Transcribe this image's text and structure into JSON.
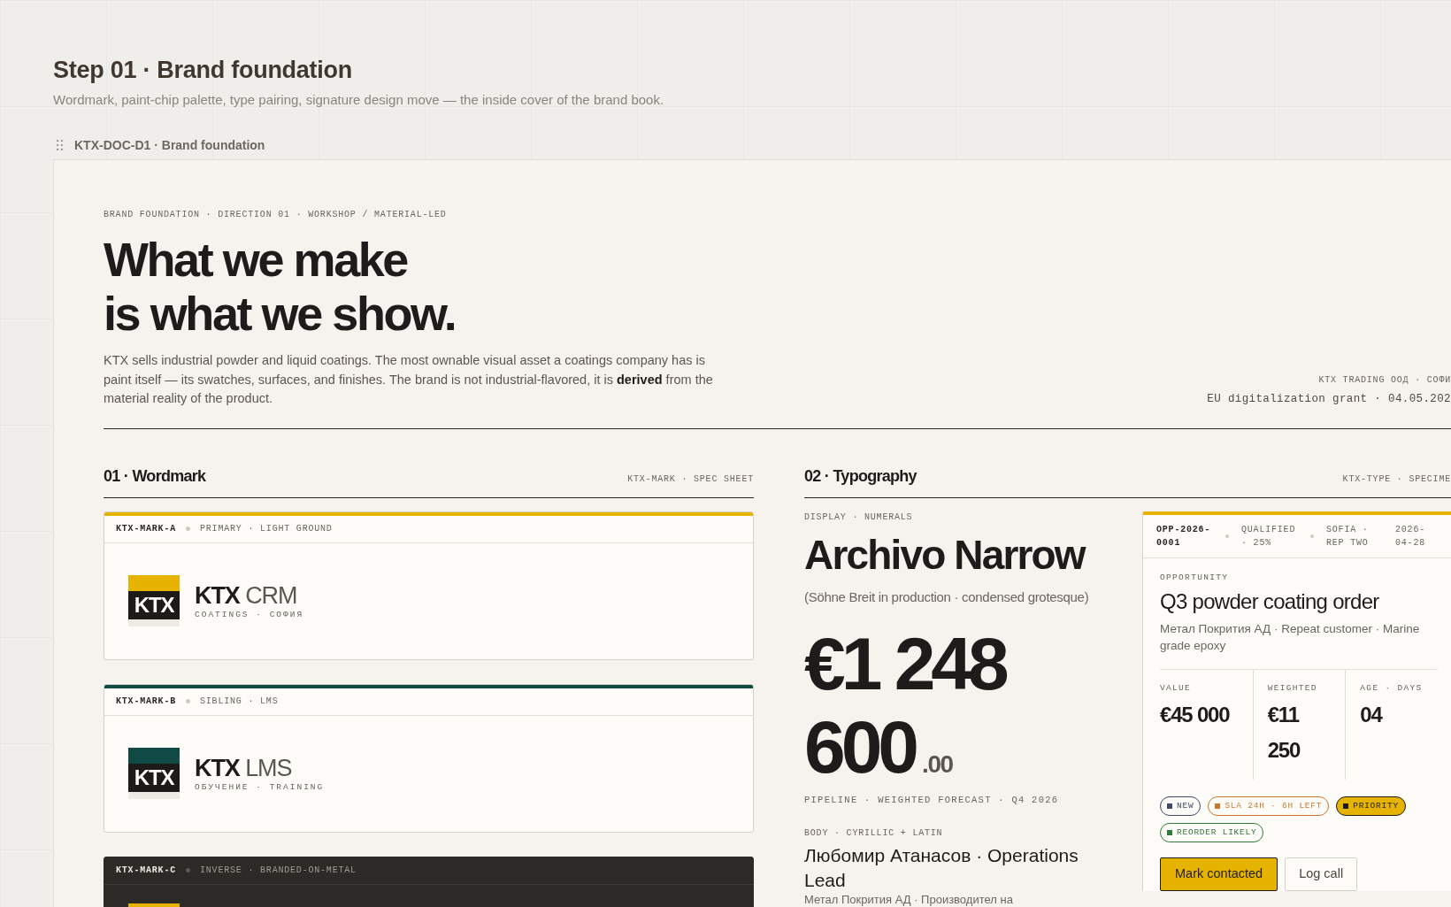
{
  "page": {
    "title": "Step 01 · Brand foundation",
    "subtitle": "Wordmark, paint-chip palette, type pairing, signature design move — the inside cover of the brand book.",
    "document_label": "KTX-DOC-D1 · Brand foundation"
  },
  "hero": {
    "eyebrow": "BRAND FOUNDATION · DIRECTION 01 · WORKSHOP / MATERIAL-LED",
    "headline": [
      "What we make",
      "is what we show."
    ],
    "intro": "KTX sells industrial powder and liquid coatings. The most ownable visual asset a coatings company has is paint itself — its swatches, surfaces, and finishes. The brand is not industrial-flavored, it is **derived** from the material reality of the product.",
    "company": "KTX TRADING ООД · СОФИ",
    "grant": "EU digitalization grant · 04.05.202"
  },
  "wordmark": {
    "title": "01 · Wordmark",
    "tag": "KTX-MARK · SPEC SHEET",
    "cards": [
      {
        "kind": "light",
        "code": "KTX-MARK-A",
        "note": "PRIMARY · LIGHT GROUND",
        "color": "#e6b400",
        "logo": "KTX",
        "name": "**KTX** CRM",
        "sub": "COATINGS · СОФИЯ"
      },
      {
        "kind": "light",
        "code": "KTX-MARK-B",
        "note": "SIBLING · LMS",
        "color": "#0f4a44",
        "logo": "KTX",
        "name": "**KTX** LMS",
        "sub": "ОБУЧЕНИЕ · TRAINING"
      },
      {
        "kind": "dark",
        "code": "KTX-MARK-C",
        "note": "INVERSE · BRANDED-ON-METAL",
        "color": "#e6b400"
      }
    ]
  },
  "typography": {
    "title": "02 · Typography",
    "tag": "KTX-TYPE · SPECIME",
    "display_label": "DISPLAY · NUMERALS",
    "font_name": "Archivo Narrow",
    "font_note": "(Söhne Breit in production · condensed grotesque)",
    "amount": "€1 248 600",
    "cents": ".00",
    "amount_caption": "PIPELINE · WEIGHTED FORECAST · Q4 2026",
    "body_label": "BODY · CYRILLIC + LATIN",
    "body_sample": "Любомир Атанасов · Operations Lead",
    "body_detail": "Метал Покрития АД · Производител на"
  },
  "opportunity": {
    "meta": [
      {
        "kind": "id",
        "text": "OPP-2026-0001",
        "dot": true
      },
      {
        "kind": "meta",
        "text": "QUALIFIED · 25%",
        "dot": true
      },
      {
        "kind": "meta",
        "text": "SOFIA · REP TWO",
        "dot": false
      },
      {
        "kind": "meta",
        "text": "2026-04-28",
        "dot": false
      }
    ],
    "eyebrow": "OPPORTUNITY",
    "title": "Q3 powder coating order",
    "description": "Метал Покрития АД · Repeat customer · Marine grade epoxy",
    "metrics": [
      {
        "label": "VALUE",
        "value": "€45 000"
      },
      {
        "label": "WEIGHTED",
        "value": "€11 250"
      },
      {
        "label": "AGE · DAYS",
        "value": "04"
      }
    ],
    "tags": [
      {
        "kind": "outline",
        "text": "NEW",
        "color": "#3e4a6a"
      },
      {
        "kind": "outline",
        "text": "SLA 24H · 6H LEFT",
        "color": "#c9782c"
      },
      {
        "kind": "solid",
        "text": "PRIORITY",
        "color": "#e6b400"
      },
      {
        "kind": "outline",
        "text": "REORDER LIKELY",
        "color": "#2f7a3c"
      }
    ],
    "buttons": [
      {
        "kind": "primary",
        "label": "Mark contacted"
      },
      {
        "kind": "secondary",
        "label": "Log call"
      }
    ]
  }
}
